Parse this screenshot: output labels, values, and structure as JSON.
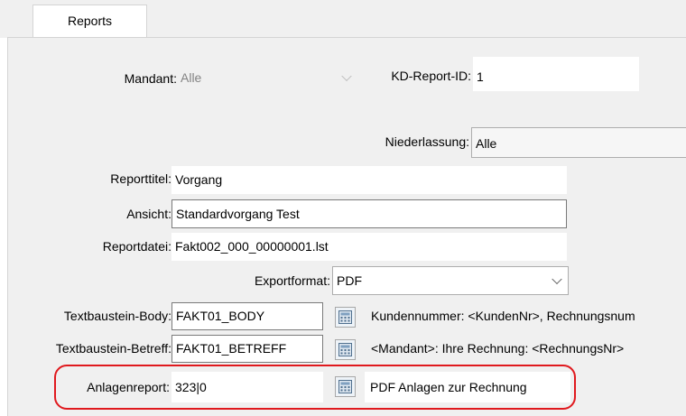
{
  "tabs": [
    {
      "label": "Reports"
    }
  ],
  "form": {
    "mandant": {
      "label": "Mandant:",
      "value": "Alle"
    },
    "kd_report_id": {
      "label": "KD-Report-ID:",
      "value": "1"
    },
    "niederlassung": {
      "label": "Niederlassung:",
      "value": "Alle"
    },
    "reporttitel": {
      "label": "Reporttitel:",
      "value": "Vorgang"
    },
    "ansicht": {
      "label": "Ansicht:",
      "value": "Standardvorgang Test"
    },
    "reportdatei": {
      "label": "Reportdatei:",
      "value": "Fakt002_000_00000001.lst"
    },
    "exportformat": {
      "label": "Exportformat:",
      "value": "PDF"
    },
    "textbaustein_body": {
      "label": "Textbaustein-Body:",
      "value": "FAKT01_BODY",
      "preview": "Kundennummer: <KundenNr>, Rechnungsnum"
    },
    "textbaustein_betreff": {
      "label": "Textbaustein-Betreff:",
      "value": "FAKT01_BETREFF",
      "preview": "<Mandant>: Ihre Rechnung: <RechnungsNr>"
    },
    "anlagenreport": {
      "label": "Anlagenreport:",
      "value": "323|0",
      "preview": "PDF Anlagen zur Rechnung"
    }
  },
  "colors": {
    "highlight": "#e0191e",
    "panel": "#f0f0f0",
    "field_border": "#7a7a7a"
  },
  "icons": [
    "chevron-down-icon",
    "calculator-icon"
  ]
}
